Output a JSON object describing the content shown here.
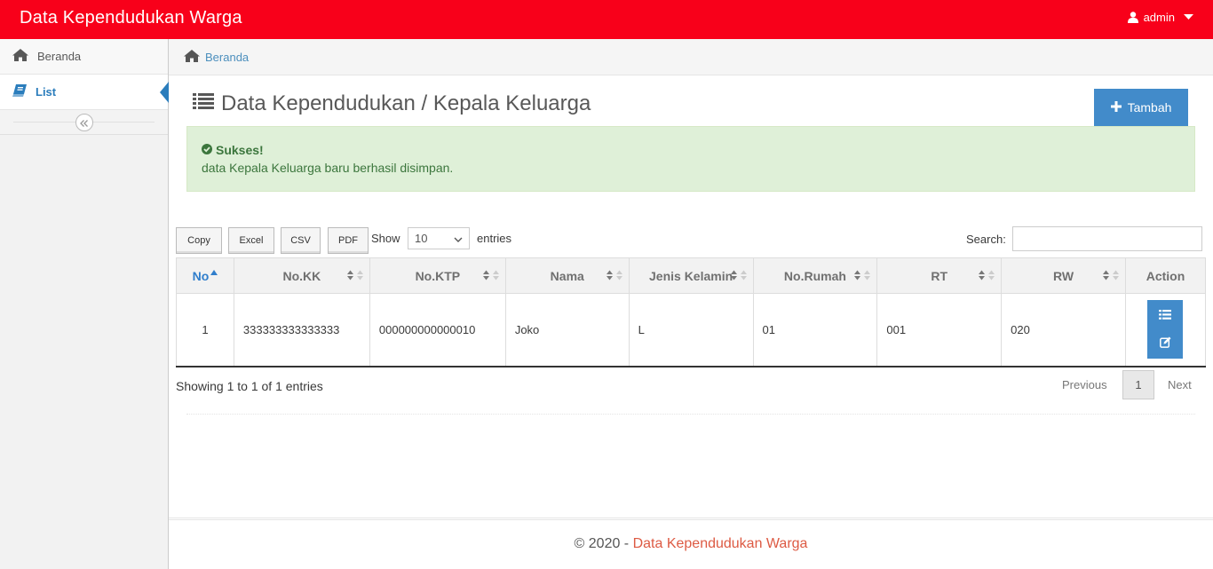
{
  "navbar": {
    "brand": "Data Kependudukan Warga",
    "user": "admin"
  },
  "sidebar": {
    "items": [
      {
        "label": "Beranda",
        "icon": "home-icon"
      },
      {
        "label": "List",
        "icon": "book-icon"
      }
    ]
  },
  "breadcrumb": {
    "home": "Beranda"
  },
  "page": {
    "title": "Data Kependudukan / Kepala Keluarga",
    "add_button": "Tambah"
  },
  "alert": {
    "title": "Sukses!",
    "message": "data Kepala Keluarga baru berhasil disimpan."
  },
  "table_controls": {
    "buttons": [
      "Copy",
      "Excel",
      "CSV",
      "PDF"
    ],
    "show_label": "Show",
    "length_value": "10",
    "entries_label": "entries",
    "search_label": "Search:"
  },
  "table": {
    "columns": [
      "No",
      "No.KK",
      "No.KTP",
      "Nama",
      "Jenis Kelamin",
      "No.Rumah",
      "RT",
      "RW",
      "Action"
    ],
    "rows": [
      {
        "no": "1",
        "kk": "333333333333333",
        "ktp": "000000000000010",
        "nama": "Joko",
        "jk": "L",
        "rumah": "01",
        "rt": "001",
        "rw": "020"
      }
    ]
  },
  "pagination": {
    "info": "Showing 1 to 1 of 1 entries",
    "previous": "Previous",
    "page": "1",
    "next": "Next"
  },
  "footer": {
    "prefix": "© 2020 - ",
    "brand": "Data Kependudukan Warga"
  },
  "colors": {
    "navbar": "#f8001a",
    "link": "#4c8fbd",
    "primary_button": "#428bca",
    "alert_bg": "#dff0d8",
    "alert_text": "#3c763d",
    "footer_brand": "#dd5a43"
  }
}
